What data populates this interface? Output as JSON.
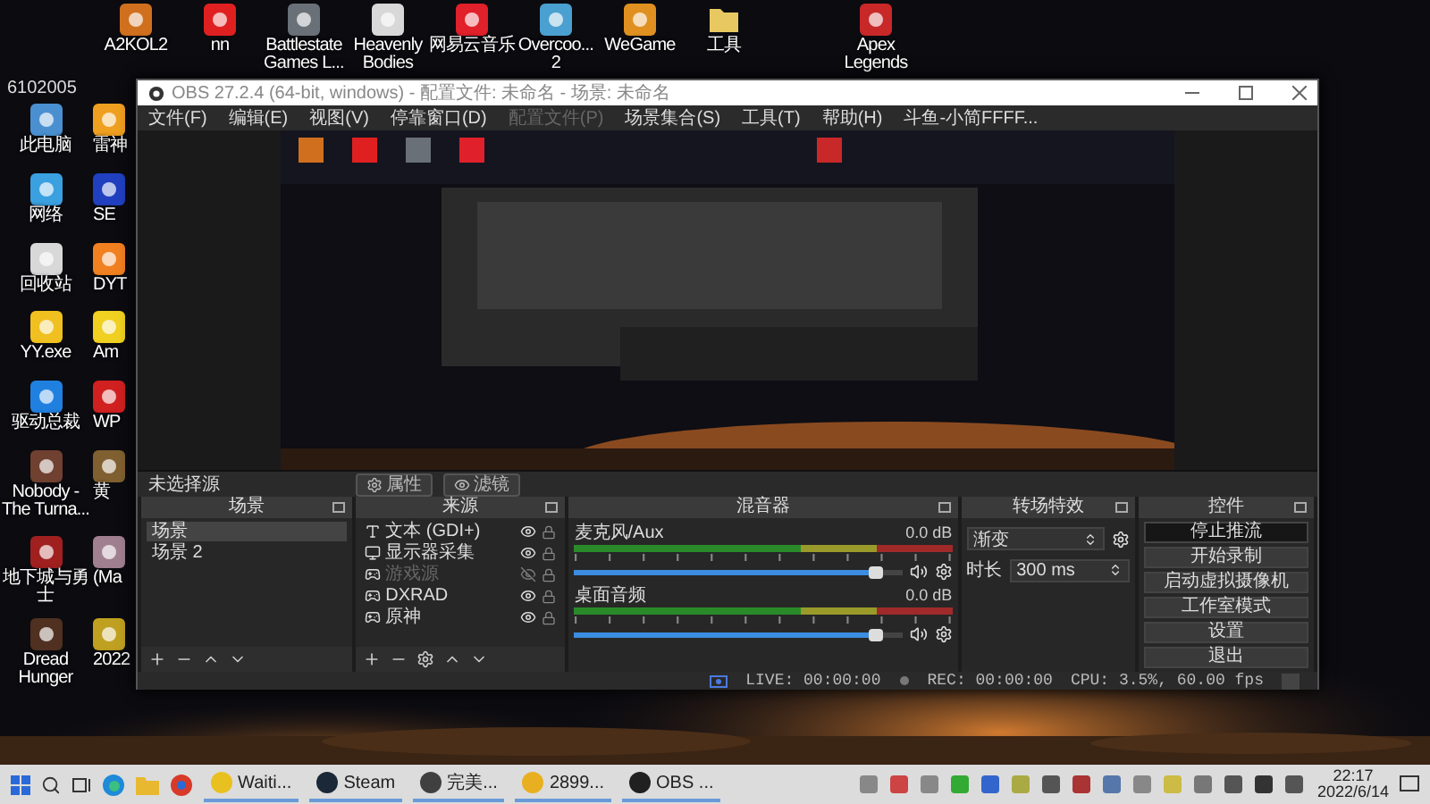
{
  "desktop": {
    "stray_label": "6102005",
    "top_icons": [
      {
        "label": "A2KOL2",
        "kind": "app",
        "color": "#d0701e"
      },
      {
        "label": "nn",
        "kind": "app",
        "color": "#e02020"
      },
      {
        "label": "Battlestate Games L...",
        "kind": "app",
        "color": "#6a7078"
      },
      {
        "label": "Heavenly Bodies",
        "kind": "app",
        "color": "#d8d8d8"
      },
      {
        "label": "网易云音乐",
        "kind": "app",
        "color": "#e0202a"
      },
      {
        "label": "Overcoo... 2",
        "kind": "app",
        "color": "#4aa0d0"
      },
      {
        "label": "WeGame",
        "kind": "app",
        "color": "#e09020"
      },
      {
        "label": "工具",
        "kind": "folder",
        "color": "#e8c860"
      },
      {
        "label": "Apex Legends",
        "kind": "app",
        "color": "#c82828"
      }
    ],
    "left_icons": [
      {
        "label": "此电脑",
        "color": "#4a90d0"
      },
      {
        "label": "网络",
        "color": "#3aa0e0"
      },
      {
        "label": "回收站",
        "color": "#d8d8d8"
      },
      {
        "label": "YY.exe",
        "color": "#f0c020"
      },
      {
        "label": "驱动总裁",
        "color": "#2080e0"
      },
      {
        "label": "Nobody - The Turna...",
        "color": "#704030"
      },
      {
        "label": "地下城与勇士",
        "color": "#a02020"
      },
      {
        "label": "Dread Hunger",
        "color": "#503020"
      }
    ],
    "second_column": [
      {
        "label": "雷神",
        "color": "#f0a020"
      },
      {
        "label": "SE",
        "color": "#2040c0"
      },
      {
        "label": "DYT",
        "color": "#f08020"
      },
      {
        "label": "Am",
        "color": "#f0d020"
      },
      {
        "label": "WP",
        "color": "#d02020"
      },
      {
        "label": "黄",
        "color": "#806030"
      },
      {
        "label": "(Ma",
        "color": "#a08090"
      },
      {
        "label": "2022",
        "color": "#c0a020"
      }
    ]
  },
  "obs": {
    "title": "OBS 27.2.4 (64-bit, windows) - 配置文件: 未命名 - 场景: 未命名",
    "menu": [
      {
        "label": "文件(F)",
        "disabled": false
      },
      {
        "label": "编辑(E)",
        "disabled": false
      },
      {
        "label": "视图(V)",
        "disabled": false
      },
      {
        "label": "停靠窗口(D)",
        "disabled": false
      },
      {
        "label": "配置文件(P)",
        "disabled": true
      },
      {
        "label": "场景集合(S)",
        "disabled": false
      },
      {
        "label": "工具(T)",
        "disabled": false
      },
      {
        "label": "帮助(H)",
        "disabled": false
      },
      {
        "label": "斗鱼-小简FFFF...",
        "disabled": false
      }
    ],
    "source_bar": {
      "label": "未选择源",
      "buttons": [
        "属性",
        "滤镜"
      ]
    },
    "scenes": {
      "title": "场景",
      "items": [
        {
          "label": "场景",
          "selected": true
        },
        {
          "label": "场景 2",
          "selected": false
        }
      ]
    },
    "sources": {
      "title": "来源",
      "items": [
        {
          "label": "文本 (GDI+)",
          "kind": "text",
          "visible": true
        },
        {
          "label": "显示器采集",
          "kind": "monitor",
          "visible": true
        },
        {
          "label": "游戏源",
          "kind": "game",
          "visible": false
        },
        {
          "label": "DXRAD",
          "kind": "game",
          "visible": true
        },
        {
          "label": "原神",
          "kind": "game",
          "visible": true
        }
      ]
    },
    "mixer": {
      "title": "混音器",
      "channels": [
        {
          "name": "麦克风/Aux",
          "reading": "0.0 dB",
          "level": 0.92
        },
        {
          "name": "桌面音频",
          "reading": "0.0 dB",
          "level": 0.92
        }
      ]
    },
    "transitions": {
      "title": "转场特效",
      "type": "渐变",
      "duration_label": "时长",
      "duration": "300 ms"
    },
    "controls": {
      "title": "控件",
      "buttons": [
        {
          "label": "停止推流",
          "active": true
        },
        {
          "label": "开始录制",
          "active": false
        },
        {
          "label": "启动虚拟摄像机",
          "active": false
        },
        {
          "label": "工作室模式",
          "active": false
        },
        {
          "label": "设置",
          "active": false
        },
        {
          "label": "退出",
          "active": false
        }
      ]
    },
    "status": {
      "live": "LIVE: 00:00:00",
      "rec": "REC: 00:00:00",
      "cpu": "CPU: 3.5%, 60.00 fps"
    }
  },
  "taskbar": {
    "apps": [
      {
        "label": "Waiti...",
        "color": "#e8c020"
      },
      {
        "label": "Steam",
        "color": "#1b2838"
      },
      {
        "label": "完美...",
        "color": "#404040"
      },
      {
        "label": "2899...",
        "color": "#e8b020"
      },
      {
        "label": "OBS ...",
        "color": "#202020"
      }
    ],
    "time": "22:17",
    "date": "2022/6/14"
  }
}
